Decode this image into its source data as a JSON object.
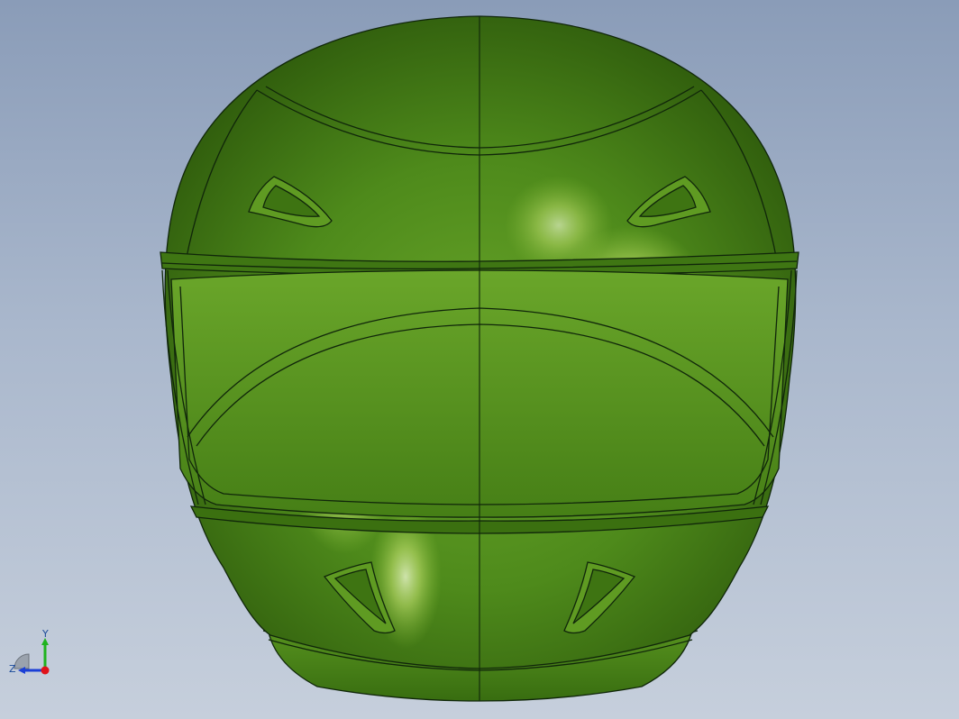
{
  "viewport": {
    "background_top": "#8a9cb8",
    "background_bottom": "#c6cfdc"
  },
  "model": {
    "object": "helmet-model",
    "color": "#4f8a18",
    "highlight_color": "#f4ffd6",
    "edge_color": "#10260a"
  },
  "triad": {
    "y_label": "Y",
    "z_label": "Z",
    "y_axis_color": "#1fb31f",
    "z_axis_color": "#1b3fd6",
    "x_axis_color": "#e0121a"
  }
}
